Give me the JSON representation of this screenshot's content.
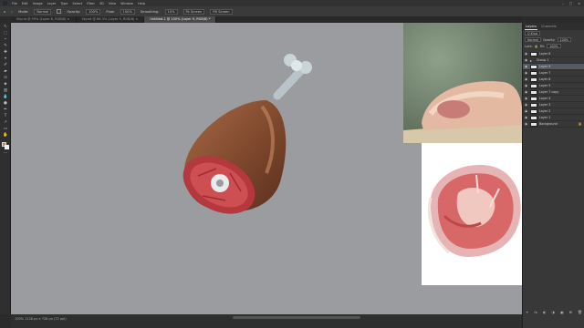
{
  "app": {
    "logo_text": "Ps"
  },
  "menu": [
    "File",
    "Edit",
    "Image",
    "Layer",
    "Type",
    "Select",
    "Filter",
    "3D",
    "View",
    "Window",
    "Help"
  ],
  "window_controls": [
    "–",
    "□",
    "×"
  ],
  "options_bar": {
    "mode_label": "Mode:",
    "mode_value": "Normal",
    "opacity_label": "Opacity:",
    "opacity_value": "100%",
    "flow_label": "Flow:",
    "flow_value": "100%",
    "smoothing_label": "Smoothing:",
    "smoothing_value": "10%",
    "fill_screen_label": "Fit Screen",
    "fill_screen2_label": "Fill Screen"
  },
  "tabs": [
    {
      "label": "Skyrid @ 59% (Layer 8, RGB/8) ×",
      "active": false
    },
    {
      "label": "Skyrid @ 66.3% (Layer 5, RGB/8) ×",
      "active": false
    },
    {
      "label": "Untitled-1 @ 100% (Layer 9, RGB/8) *",
      "active": true
    }
  ],
  "tools": [
    "↖",
    "⬚",
    "⌁",
    "✎",
    "✚",
    "⌖",
    "✐",
    "▰",
    "⊙",
    "⬥",
    "T",
    "↗",
    "▭",
    "✋",
    "⌕",
    "···"
  ],
  "colors": {
    "foreground": "#d4873a",
    "background": "#f0f0f0",
    "canvas": "#9b9ca0"
  },
  "status": {
    "text": "100% 1128 px x 728 px (72 ppi)"
  },
  "panel": {
    "tabs": [
      {
        "label": "Layers",
        "active": true
      },
      {
        "label": "Channels",
        "active": false
      }
    ],
    "kind_label": "Q Kind",
    "blend_mode": "Normal",
    "opacity_label": "Opacity:",
    "opacity_value": "100%",
    "lock_label": "Lock:",
    "fill_label": "Fill:",
    "fill_value": "100%",
    "layers": [
      {
        "name": "Layer 8",
        "type": "layer",
        "selected": false
      },
      {
        "name": "Group 1",
        "type": "group",
        "selected": false
      },
      {
        "name": "Layer 9",
        "type": "layer",
        "selected": true
      },
      {
        "name": "Layer 7",
        "type": "layer",
        "selected": false
      },
      {
        "name": "Layer 6",
        "type": "layer",
        "selected": false
      },
      {
        "name": "Layer 5",
        "type": "layer",
        "selected": false
      },
      {
        "name": "Layer 7 copy",
        "type": "layer",
        "selected": false
      },
      {
        "name": "Layer 4",
        "type": "layer",
        "selected": false
      },
      {
        "name": "Layer 3",
        "type": "layer",
        "selected": false
      },
      {
        "name": "Layer 2",
        "type": "layer",
        "selected": false
      },
      {
        "name": "Layer 1",
        "type": "layer",
        "selected": false
      },
      {
        "name": "Background",
        "type": "background",
        "selected": false
      }
    ],
    "footer_icons": [
      "⚭",
      "fx",
      "◐",
      "◑",
      "▣",
      "⊞",
      "🗑"
    ]
  }
}
